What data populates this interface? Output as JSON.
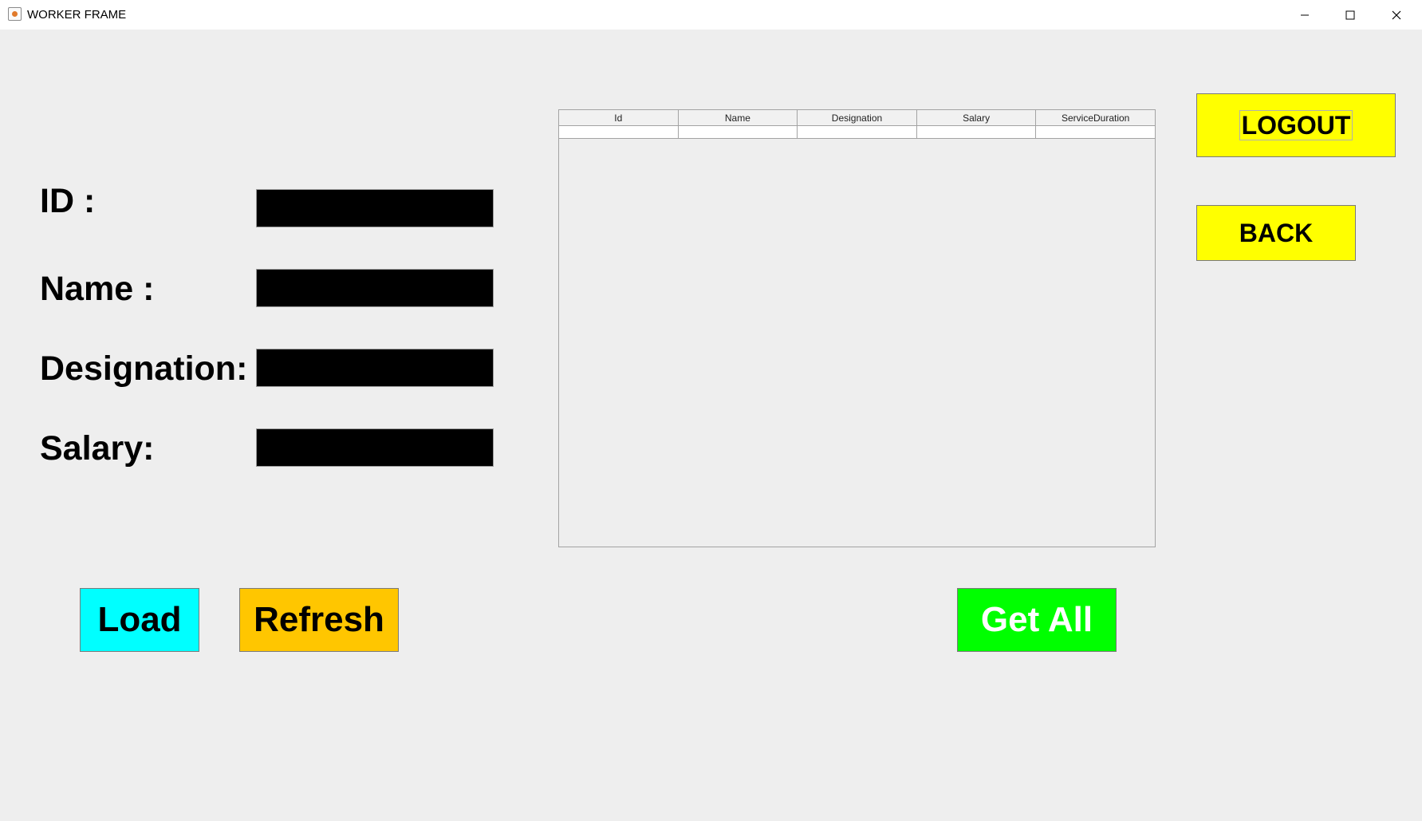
{
  "window": {
    "title": "WORKER FRAME"
  },
  "form": {
    "id_label": "ID :",
    "name_label": "Name :",
    "designation_label": "Designation:",
    "salary_label": "Salary:",
    "id_value": "",
    "name_value": "",
    "designation_value": "",
    "salary_value": ""
  },
  "table": {
    "columns": [
      "Id",
      "Name",
      "Designation",
      "Salary",
      "ServiceDuration"
    ]
  },
  "buttons": {
    "logout": "LOGOUT",
    "back": "BACK",
    "load": "Load",
    "refresh": "Refresh",
    "get_all": "Get All"
  },
  "colors": {
    "logout_bg": "#ffff00",
    "back_bg": "#ffff00",
    "load_bg": "#00ffff",
    "refresh_bg": "#ffc600",
    "get_all_bg": "#00ff00",
    "get_all_text": "#ffffff",
    "field_bg": "#000000"
  }
}
